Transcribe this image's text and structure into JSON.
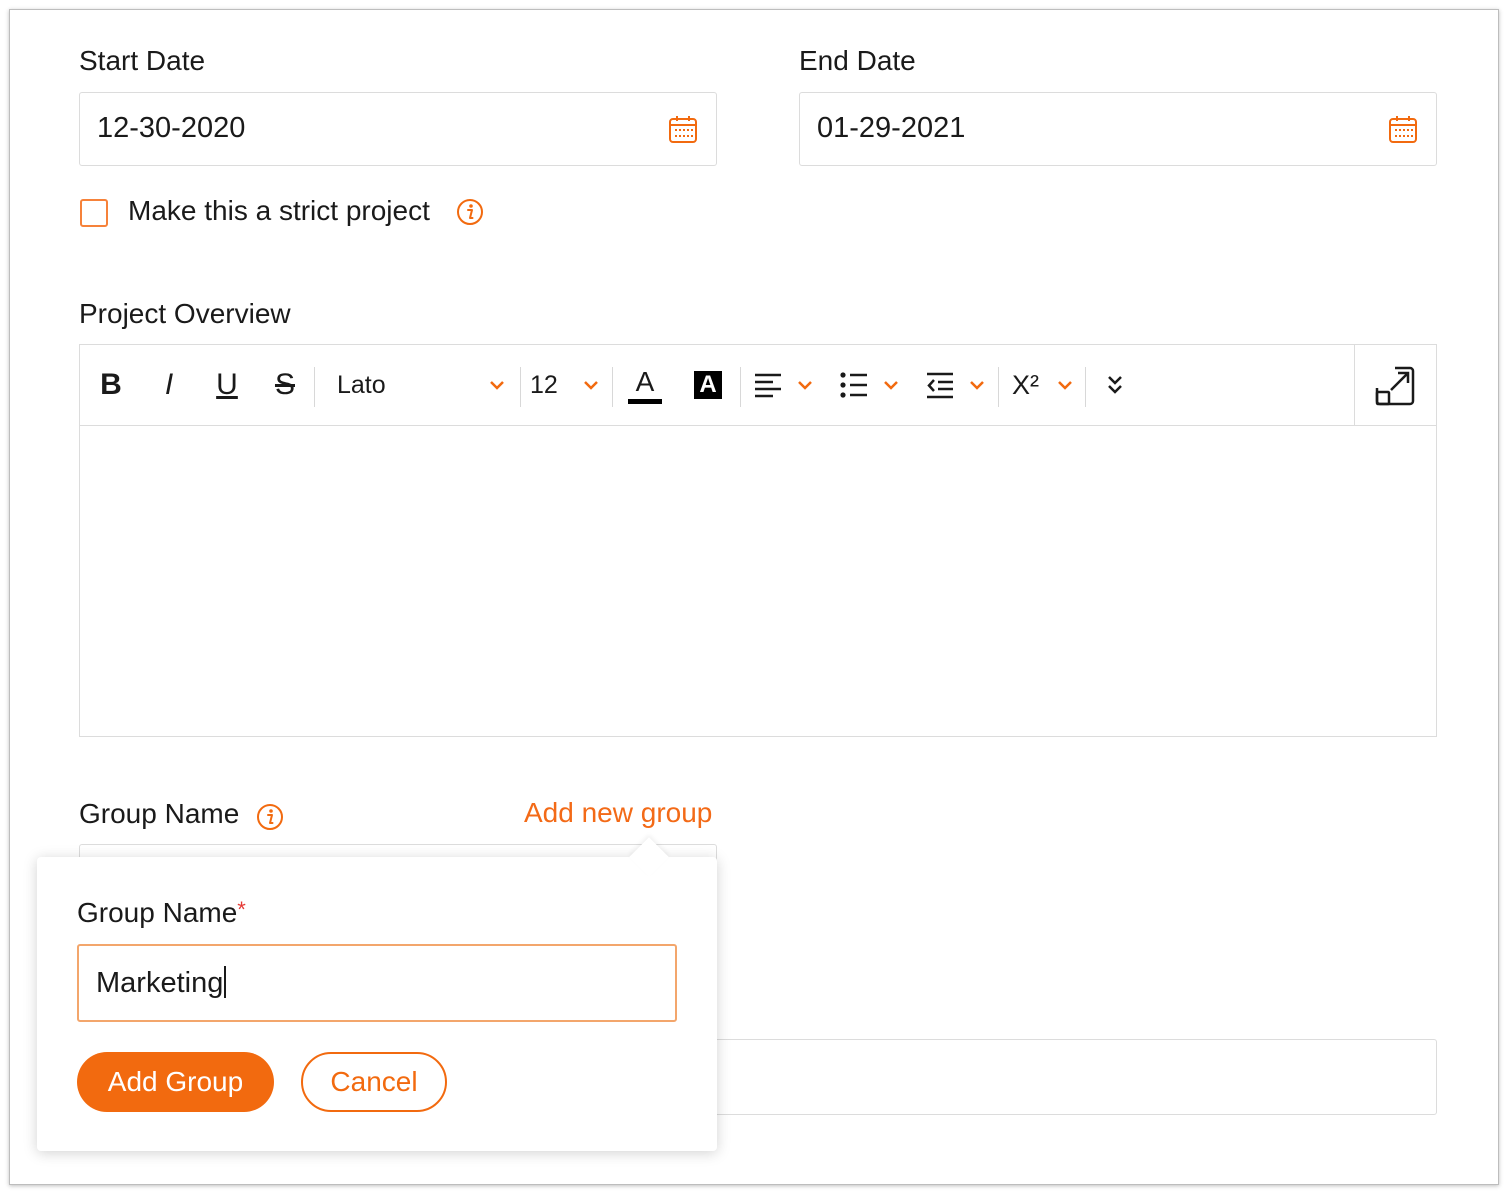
{
  "colors": {
    "accent": "#f26a0f",
    "border": "#dcdcdc",
    "text": "#1a1a1a",
    "required": "#e53935"
  },
  "start_date": {
    "label": "Start Date",
    "value": "12-30-2020",
    "icon": "calendar-icon"
  },
  "end_date": {
    "label": "End Date",
    "value": "01-29-2021",
    "icon": "calendar-icon"
  },
  "strict_project": {
    "label": "Make this a strict project",
    "checked": false,
    "icon": "info-icon"
  },
  "overview": {
    "label": "Project Overview",
    "content": "",
    "toolbar": {
      "bold": "B",
      "italic": "I",
      "underline": "U",
      "strikethrough": "S",
      "font_family": "Lato",
      "font_size": "12",
      "font_color": "A",
      "highlight": "A",
      "align_icon": "align-left-icon",
      "list_icon": "bullet-list-icon",
      "indent_icon": "outdent-icon",
      "superscript": "X²",
      "more_icon": "double-chevron-down-icon",
      "expand_icon": "expand-icon"
    }
  },
  "group": {
    "label": "Group Name",
    "add_link": "Add new group",
    "icon": "info-icon"
  },
  "popover": {
    "label": "Group Name",
    "required_mark": "*",
    "input_value": "Marketing",
    "add_button": "Add Group",
    "cancel_button": "Cancel"
  }
}
